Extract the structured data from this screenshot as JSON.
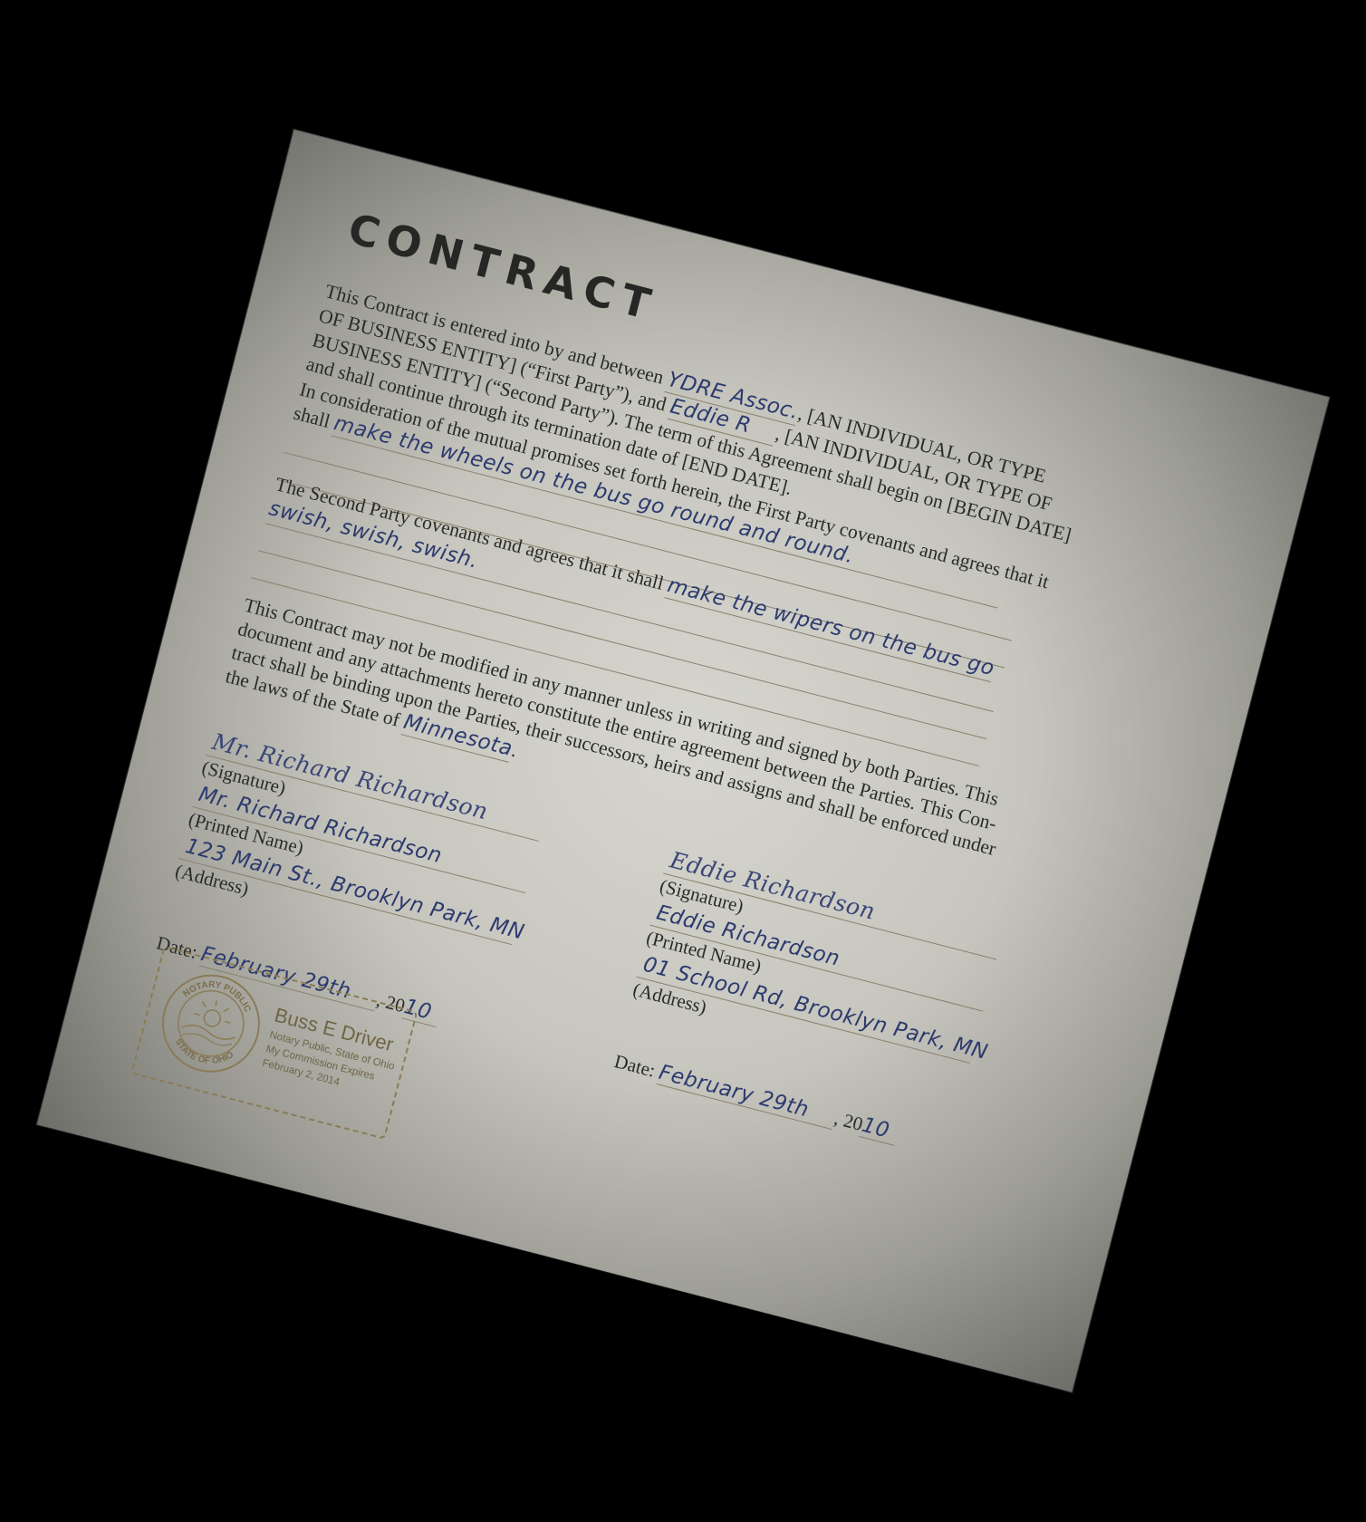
{
  "title": "CONTRACT",
  "para1": {
    "t1": "This Contract is entered into by and between",
    "first_party": "YDRE Assoc.",
    "t2": ", [AN INDIVIDUAL, OR TYPE",
    "t3": "OF BUSINESS ENTITY] (“First Party”), and",
    "second_party": "Eddie R",
    "t4": ", [AN INDIVIDUAL, OR TYPE OF",
    "t5": "BUSINESS ENTITY] (“Second Party”).   The term of this Agreement shall begin on [BEGIN DATE]",
    "t6": "and shall continue through its termination date of [END DATE]."
  },
  "para2": {
    "t1": "In consideration of the mutual promises set forth herein, the First Party covenants and agrees that it",
    "t2": "shall",
    "hand": "make the wheels on the bus go round and round."
  },
  "para3": {
    "t1": "The Second Party covenants and agrees that it shall",
    "hand1": "make the wipers on the bus go",
    "hand2": "swish, swish, swish."
  },
  "para4": {
    "t1": "This Contract may not be modified in any manner unless in writing and signed by both Parties. This",
    "t2": "document and any attachments hereto constitute the entire agreement between the Parties.  This Con-",
    "t3": "tract shall be binding upon the Parties, their successors, heirs and assigns and shall be enforced under",
    "t4": "the laws of the State of",
    "state": "Minnesota",
    "t5": "."
  },
  "left_party": {
    "signature": "Mr. Richard Richardson",
    "signature_label": "(Signature)",
    "printed_name": "Mr. Richard Richardson",
    "printed_label": "(Printed Name)",
    "address": "123 Main St., Brooklyn Park, MN",
    "address_label": "(Address)",
    "date_label": "Date:",
    "date_value": "February 29th",
    "year_prefix": ", 20",
    "year_value": "10"
  },
  "right_party": {
    "signature": "Eddie Richardson",
    "signature_label": "(Signature)",
    "printed_name": "Eddie Richardson",
    "printed_label": "(Printed Name)",
    "address": "01 School Rd, Brooklyn Park, MN",
    "address_label": "(Address)",
    "date_label": "Date:",
    "date_value": "February 29th",
    "year_prefix": ", 20",
    "year_value": "10"
  },
  "notary_stamp": {
    "ring_top": "NOTARY PUBLIC",
    "ring_bottom": "STATE OF OHIO",
    "name": "Buss E Driver",
    "line1": "Notary Public, State of Ohio",
    "line2": "My Commission Expires",
    "line3": "February 2, 2014"
  }
}
